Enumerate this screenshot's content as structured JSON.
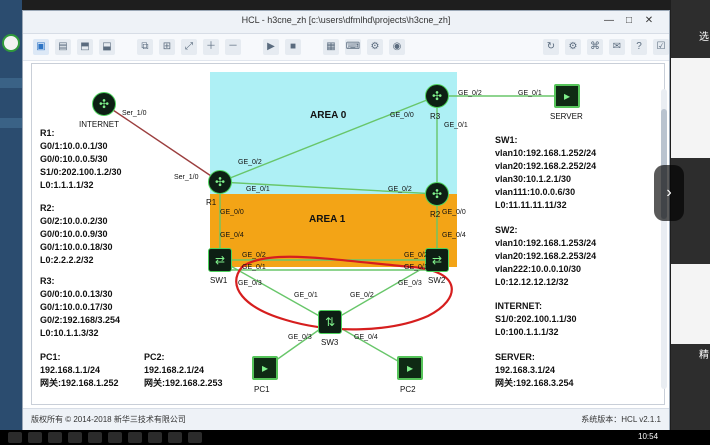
{
  "window": {
    "title": "HCL - h3cne_zh [c:\\users\\dfmlhd\\projects\\h3cne_zh]",
    "controls": {
      "minimize": "—",
      "maximize": "□",
      "close": "✕"
    }
  },
  "toolbar": {
    "icons": [
      "open-project-icon",
      "folder-icon",
      "save-icon",
      "save-as-icon",
      "screenshot-icon",
      "layout-icon",
      "fit-icon",
      "zoom-in-icon",
      "zoom-out-icon",
      "play-icon",
      "stop-icon",
      "interface-icon",
      "cli-icon",
      "settings-icon",
      "capture-icon",
      "refresh-icon",
      "gear-icon",
      "cmd-icon",
      "chat-icon",
      "help-icon",
      "feedback-icon"
    ]
  },
  "topology": {
    "areas": {
      "area0": "AREA 0",
      "area1": "AREA 1"
    },
    "devices": {
      "internet": "INTERNET",
      "server": "SERVER",
      "r1": "R1",
      "r2": "R2",
      "r3": "R3",
      "sw1": "SW1",
      "sw2": "SW2",
      "sw3": "SW3",
      "pc1": "PC1",
      "pc2": "PC2"
    },
    "ports": {
      "internet_s10": "Ser_1/0",
      "r1_s10": "Ser_1/0",
      "r1_ge02": "GE_0/2",
      "r1_ge01": "GE_0/1",
      "r1_ge00": "GE_0/0",
      "r1_ge04": "GE_0/4",
      "r2_ge02": "GE_0/2",
      "r2_ge00": "GE_0/0",
      "r2_ge04": "GE_0/4",
      "r3_ge00": "GE_0/0",
      "r3_ge01": "GE_0/1",
      "r3_ge02": "GE_0/2",
      "server_ge01": "GE_0/1",
      "sw1_ge02": "GE_0/2",
      "sw1_ge01": "GE_0/1",
      "sw1_ge03": "GE_0/3",
      "sw2_ge02": "GE_0/2",
      "sw2_ge01": "GE_0/1",
      "sw2_ge03": "GE_0/3",
      "sw3_ge01": "GE_0/1",
      "sw3_ge02": "GE_0/2",
      "sw3_ge03": "GE_0/3",
      "sw3_ge04": "GE_0/4"
    },
    "left_notes": {
      "r1": [
        "R1:",
        "G0/1:10.0.0.1/30",
        "G0/0:10.0.0.5/30",
        "S1/0:202.100.1.2/30",
        "L0:1.1.1.1/32"
      ],
      "r2": [
        "R2:",
        "G0/2:10.0.0.2/30",
        "G0/0:10.0.0.9/30",
        "G0/1:10.0.0.18/30",
        "L0:2.2.2.2/32"
      ],
      "r3": [
        "R3:",
        "G0/0:10.0.0.13/30",
        "G0/1:10.0.0.17/30",
        "G0/2:192.168/3.254",
        "L0:10.1.1.3/32"
      ],
      "pc1": [
        "PC1:",
        "192.168.1.1/24",
        "网关:192.168.1.252"
      ],
      "pc2": [
        "PC2:",
        "192.168.2.1/24",
        "网关:192.168.2.253"
      ]
    },
    "right_notes": {
      "sw1": [
        "SW1:",
        "vlan10:192.168.1.252/24",
        "vlan20:192.168.2.252/24",
        "vlan30:10.1.2.1/30",
        "vlan111:10.0.0.6/30",
        "L0:11.11.11.11/32"
      ],
      "sw2": [
        "SW2:",
        "vlan10:192.168.1.253/24",
        "vlan20:192.168.2.253/24",
        "vlan222:10.0.0.10/30",
        "L0:12.12.12.12/32"
      ],
      "internet": [
        "INTERNET:",
        "S1/0:202.100.1.1/30",
        "L0:100.1.1.1/32"
      ],
      "server": [
        "SERVER:",
        "192.168.3.1/24",
        "网关:192.168.3.254"
      ]
    }
  },
  "statusbar": {
    "left": "版权所有 © 2014-2018 新华三技术有限公司",
    "right": "系统版本：HCL v2.1.1"
  },
  "right_panel": {
    "top_text": "选",
    "mid_text": "精"
  },
  "taskbar": {
    "time": "10:54"
  }
}
